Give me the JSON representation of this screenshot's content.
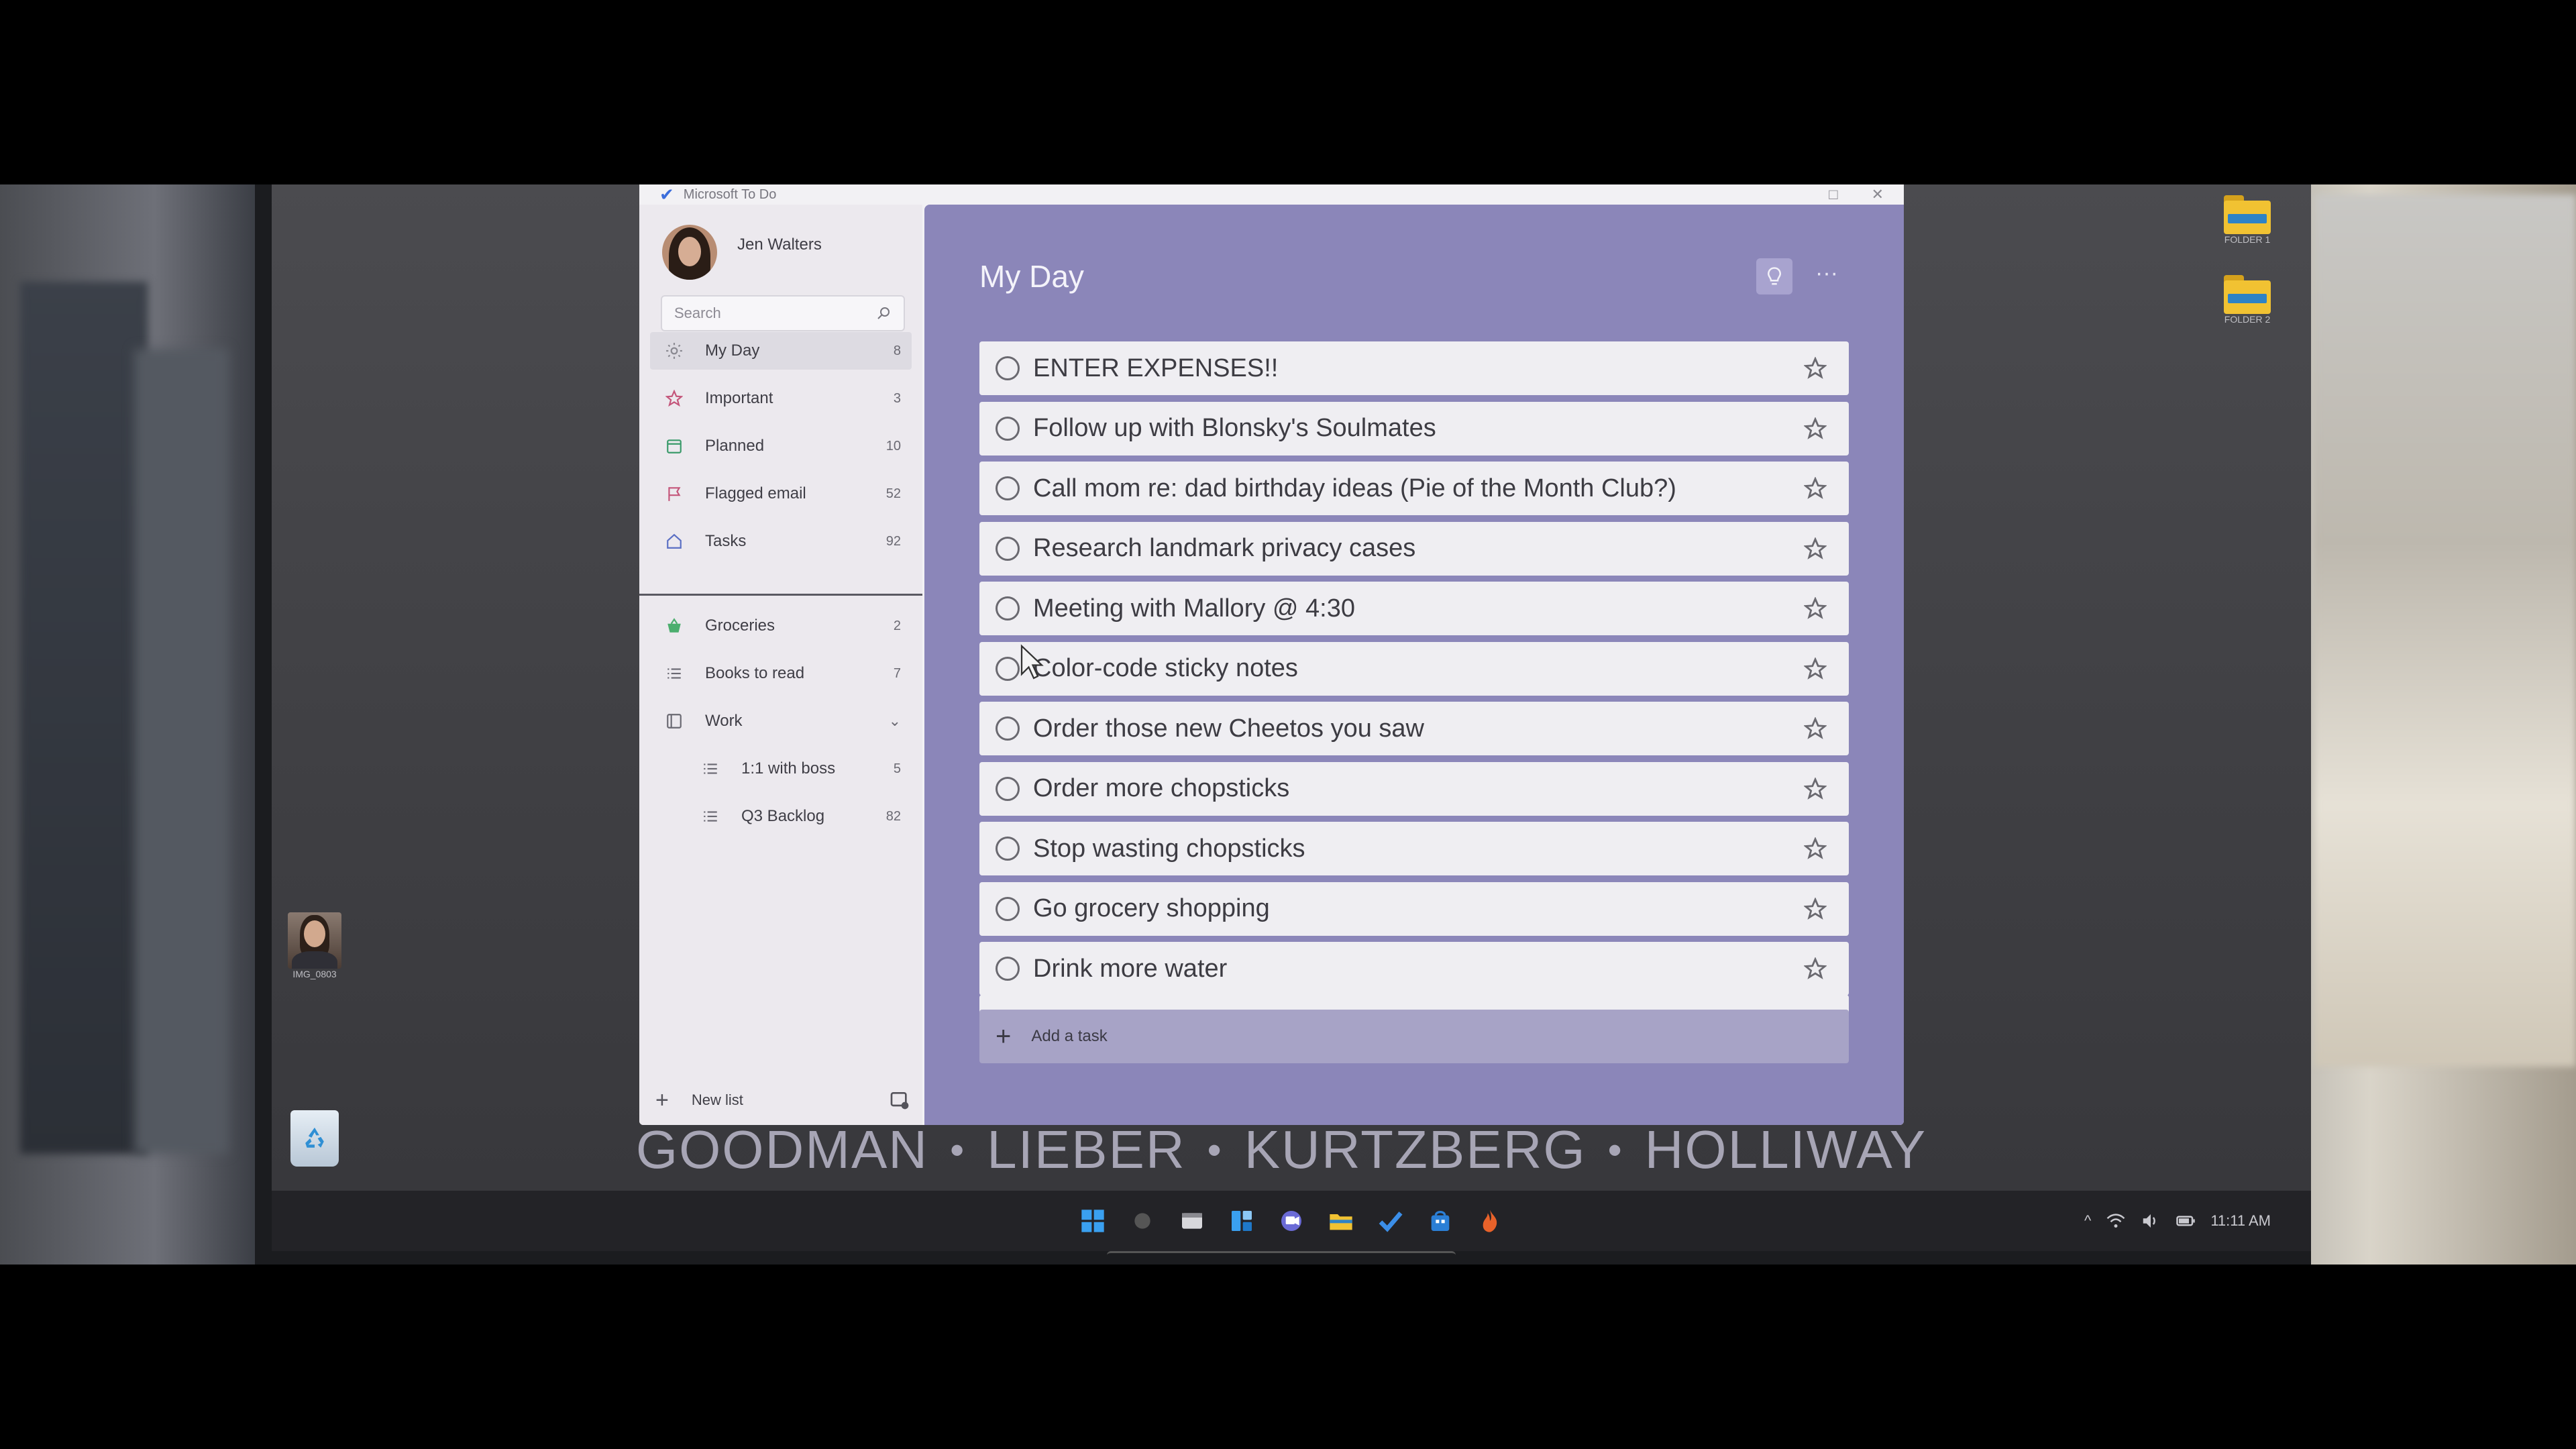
{
  "app": {
    "title": "Microsoft To Do",
    "user_name": "Jen Walters"
  },
  "search": {
    "placeholder": "Search"
  },
  "sidebar": {
    "items": [
      {
        "label": "My Day",
        "count": "8",
        "icon": "sun-icon"
      },
      {
        "label": "Important",
        "count": "3",
        "icon": "star-icon"
      },
      {
        "label": "Planned",
        "count": "10",
        "icon": "calendar-icon"
      },
      {
        "label": "Flagged email",
        "count": "52",
        "icon": "flag-icon"
      },
      {
        "label": "Tasks",
        "count": "92",
        "icon": "home-icon"
      }
    ],
    "lists": [
      {
        "label": "Groceries",
        "count": "2",
        "icon": "basket-icon"
      },
      {
        "label": "Books to read",
        "count": "7",
        "icon": "list-icon"
      },
      {
        "label": "Work",
        "count": "",
        "icon": "group-icon"
      },
      {
        "label": "1:1 with boss",
        "count": "5",
        "icon": "list-icon"
      },
      {
        "label": "Q3 Backlog",
        "count": "82",
        "icon": "list-icon"
      }
    ],
    "new_list_label": "New list"
  },
  "main": {
    "title": "My Day",
    "tasks": [
      "ENTER EXPENSES!!",
      "Follow up with Blonsky's Soulmates",
      "Call mom re: dad birthday ideas (Pie of the Month Club?)",
      "Research landmark privacy cases",
      "Meeting with Mallory @ 4:30",
      "Color-code sticky notes",
      "Order those new Cheetos you saw",
      "Order more chopsticks",
      "Stop wasting chopsticks",
      "Go grocery shopping",
      "Drink more water"
    ],
    "add_task_label": "Add a task"
  },
  "desktop": {
    "folder1_label": "FOLDER 1",
    "folder2_label": "FOLDER 2",
    "photo_label": "IMG_0803"
  },
  "firm": {
    "names": [
      "GOODMAN",
      "LIEBER",
      "KURTZBERG",
      "HOLLIWAY"
    ],
    "separator": "•"
  },
  "tray": {
    "time": "11:11 AM"
  },
  "colors": {
    "main_bg": "#8b86b9",
    "sidebar_bg": "#ece9ee",
    "accent_blue": "#3b6ddb"
  }
}
